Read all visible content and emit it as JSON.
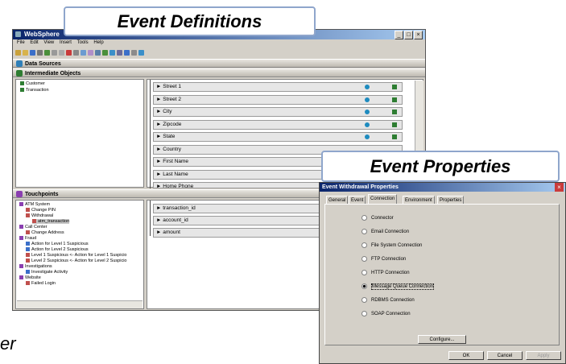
{
  "window": {
    "title": "WebSphere"
  },
  "menu": [
    "File",
    "Edit",
    "View",
    "Insert",
    "Tools",
    "Help"
  ],
  "sections": {
    "data_sources": "Data Sources",
    "intermediate_objects": "Intermediate Objects",
    "touchpoints": "Touchpoints"
  },
  "intermediate_tree": [
    "Customer",
    "Transaction"
  ],
  "fields_top": [
    "Street 1",
    "Street 2",
    "City",
    "Zipcode",
    "State",
    "Country",
    "First Name",
    "Last Name",
    "Home Phone"
  ],
  "touchpoint_tree": [
    "ATM System",
    "Change PIN",
    "Withdrawal",
    "atm_transaction",
    "Call Center",
    "Change Address",
    "Fraud",
    "Action for Level 1 Suspicious",
    "Action for Level 2 Suspicious",
    "Level 1 Suspicious <- Action for Level 1 Suspicio",
    "Level 2 Suspicious <- Action for Level 2 Suspicio",
    "Investigations",
    "Investigate Activity",
    "Website",
    "Failed Login"
  ],
  "fields_bottom": [
    "transaction_id",
    "account_id",
    "amount"
  ],
  "callouts": {
    "event_definitions": "Event Definitions",
    "event_properties": "Event Properties",
    "partial": "er"
  },
  "dialog": {
    "title": "Event Withdrawal Properties",
    "tabs": [
      "General",
      "Event",
      "Connection",
      "Environment",
      "Properties"
    ],
    "options": [
      "Connector",
      "Email Connection",
      "File System Connection",
      "FTP Connection",
      "HTTP Connection",
      "Message Queue Connection",
      "RDBMS Connection",
      "SOAP Connection"
    ],
    "selected": "Message Queue Connection",
    "configure": "Configure...",
    "ok": "OK",
    "cancel": "Cancel",
    "apply": "Apply"
  }
}
